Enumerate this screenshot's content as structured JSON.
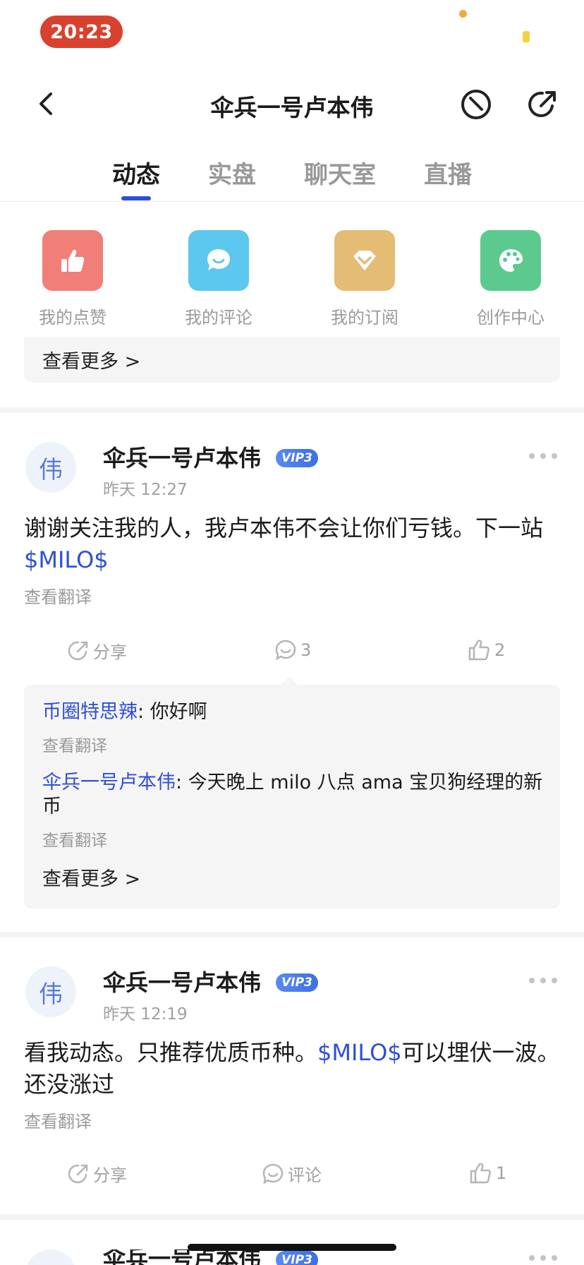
{
  "status_bar": {
    "time": "20:23"
  },
  "nav": {
    "title": "伞兵一号卢本伟",
    "back_icon": "chevron-left-icon",
    "block_icon": "block-icon",
    "share_icon": "share-external-icon"
  },
  "tabs": [
    {
      "label": "动态",
      "active": true
    },
    {
      "label": "实盘",
      "active": false
    },
    {
      "label": "聊天室",
      "active": false
    },
    {
      "label": "直播",
      "active": false
    }
  ],
  "quick_links": [
    {
      "label": "我的点赞",
      "icon": "thumbs-up-icon",
      "color": "#f07f78"
    },
    {
      "label": "我的评论",
      "icon": "comment-icon",
      "color": "#5cc7ef"
    },
    {
      "label": "我的订阅",
      "icon": "diamond-icon",
      "color": "#e5bc74"
    },
    {
      "label": "创作中心",
      "icon": "palette-icon",
      "color": "#5cc98f"
    }
  ],
  "top_more": "查看更多 >",
  "posts": [
    {
      "avatar": "伟",
      "author": "伞兵一号卢本伟",
      "vip": "VIP3",
      "time": "昨天 12:27",
      "body_before": "谢谢关注我的人，我卢本伟不会让你们亏钱。下一站",
      "ticker": "$MILO$",
      "body_after": "",
      "translate": "查看翻译",
      "share": "分享",
      "comments": "3",
      "likes": "2",
      "comment_list": [
        {
          "user": "币圈特思辣",
          "text": ": 你好啊",
          "translate": "查看翻译"
        },
        {
          "user": "伞兵一号卢本伟",
          "text": ": 今天晚上 milo 八点 ama   宝贝狗经理的新币",
          "translate": "查看翻译"
        }
      ],
      "comments_more": "查看更多 >"
    },
    {
      "avatar": "伟",
      "author": "伞兵一号卢本伟",
      "vip": "VIP3",
      "time": "昨天 12:19",
      "body_before": "看我动态。只推荐优质币种。",
      "ticker": "$MILO$",
      "body_after": "可以埋伏一波。还没涨过",
      "translate": "查看翻译",
      "share": "分享",
      "comments": "评论",
      "likes": "1"
    },
    {
      "avatar": "伟",
      "author": "伞兵一号卢本伟",
      "vip": "VIP3"
    }
  ]
}
